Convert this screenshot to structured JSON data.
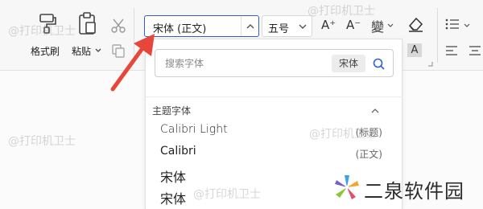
{
  "ribbon": {
    "format_painter_label": "格式刷",
    "paste_label": "粘贴",
    "font_name_value": "宋体 (正文)",
    "font_size_value": "五号",
    "font_grow_glyph": "A⁺",
    "font_shrink_glyph": "A⁻",
    "phonetic_glyph": "變",
    "char_shading_glyph": "A",
    "icons": [
      "format-painter-icon",
      "paste-icon",
      "cut-icon",
      "copy-icon",
      "font-grow-icon",
      "font-shrink-icon",
      "phonetic-guide-icon",
      "clear-format-icon",
      "character-shading-icon",
      "bullet-list-icon",
      "align-left-icon",
      "align-center-icon"
    ]
  },
  "font_dropdown": {
    "search_placeholder": "搜索字体",
    "search_chip": "宋体",
    "section_title": "主题字体",
    "fonts": [
      {
        "name": "Calibri Light",
        "tag": "(标题)"
      },
      {
        "name": "Calibri",
        "tag": "(正文)"
      },
      {
        "name": "宋体",
        "tag": ""
      },
      {
        "name": "宋体",
        "tag": ""
      }
    ]
  },
  "watermarks": [
    "@打印机卫士",
    "@打印机卫士",
    "@打印机卫士",
    "@打印机卫士",
    "@打印机卫士"
  ],
  "brand": {
    "name": "二泉软件园"
  },
  "colors": {
    "accent_blue": "#2f5fd3",
    "arrow_red": "#e8463a"
  }
}
